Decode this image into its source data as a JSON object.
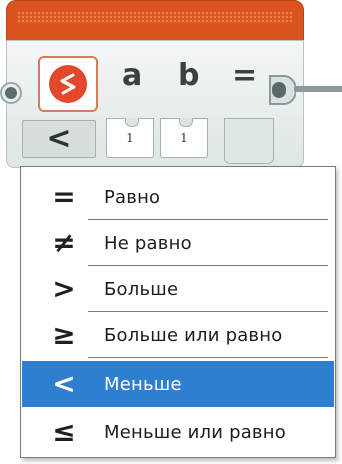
{
  "block": {
    "param_a": "a",
    "param_b": "b",
    "operator_sign": "=",
    "mode_symbol": "<",
    "input_a_value": "1",
    "input_b_value": "1",
    "header_color": "#d9541e",
    "icon_color": "#e3482c"
  },
  "menu": {
    "items": [
      {
        "symbol": "=",
        "label": "Равно"
      },
      {
        "symbol": "≠",
        "label": "Не равно"
      },
      {
        "symbol": ">",
        "label": "Больше"
      },
      {
        "symbol": "≥",
        "label": "Больше или равно"
      },
      {
        "symbol": "<",
        "label": "Меньше"
      },
      {
        "symbol": "≤",
        "label": "Меньше или равно"
      }
    ],
    "selected_label": "Меньше",
    "highlight_color": "#2f7fd1"
  }
}
